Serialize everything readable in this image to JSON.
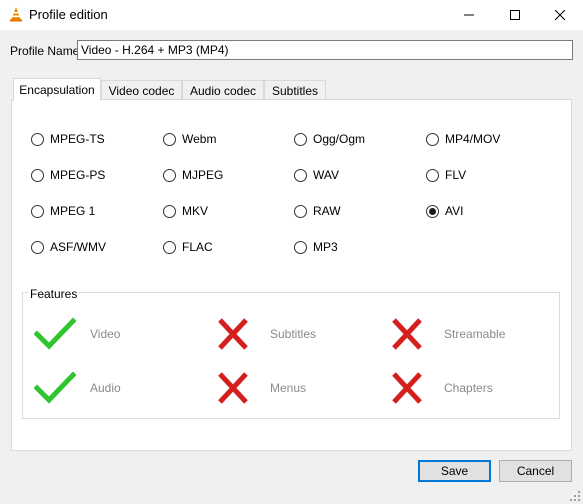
{
  "window": {
    "title": "Profile edition"
  },
  "profile": {
    "name_label": "Profile Name",
    "name_value": "Video - H.264 + MP3 (MP4)"
  },
  "tabs": [
    {
      "label": "Encapsulation",
      "active": true
    },
    {
      "label": "Video codec",
      "active": false
    },
    {
      "label": "Audio codec",
      "active": false
    },
    {
      "label": "Subtitles",
      "active": false
    }
  ],
  "encapsulation": {
    "options": [
      {
        "label": "MPEG-TS",
        "checked": false
      },
      {
        "label": "Webm",
        "checked": false
      },
      {
        "label": "Ogg/Ogm",
        "checked": false
      },
      {
        "label": "MP4/MOV",
        "checked": false
      },
      {
        "label": "MPEG-PS",
        "checked": false
      },
      {
        "label": "MJPEG",
        "checked": false
      },
      {
        "label": "WAV",
        "checked": false
      },
      {
        "label": "FLV",
        "checked": false
      },
      {
        "label": "MPEG 1",
        "checked": false
      },
      {
        "label": "MKV",
        "checked": false
      },
      {
        "label": "RAW",
        "checked": false
      },
      {
        "label": "AVI",
        "checked": true
      },
      {
        "label": "ASF/WMV",
        "checked": false
      },
      {
        "label": "FLAC",
        "checked": false
      },
      {
        "label": "MP3",
        "checked": false
      }
    ]
  },
  "features": {
    "title": "Features",
    "items": [
      {
        "label": "Video",
        "supported": true
      },
      {
        "label": "Subtitles",
        "supported": false
      },
      {
        "label": "Streamable",
        "supported": false
      },
      {
        "label": "Audio",
        "supported": true
      },
      {
        "label": "Menus",
        "supported": false
      },
      {
        "label": "Chapters",
        "supported": false
      }
    ]
  },
  "buttons": {
    "save": "Save",
    "cancel": "Cancel"
  },
  "colors": {
    "check": "#2ec52e",
    "cross": "#d41f1f",
    "focus": "#0078d7"
  }
}
